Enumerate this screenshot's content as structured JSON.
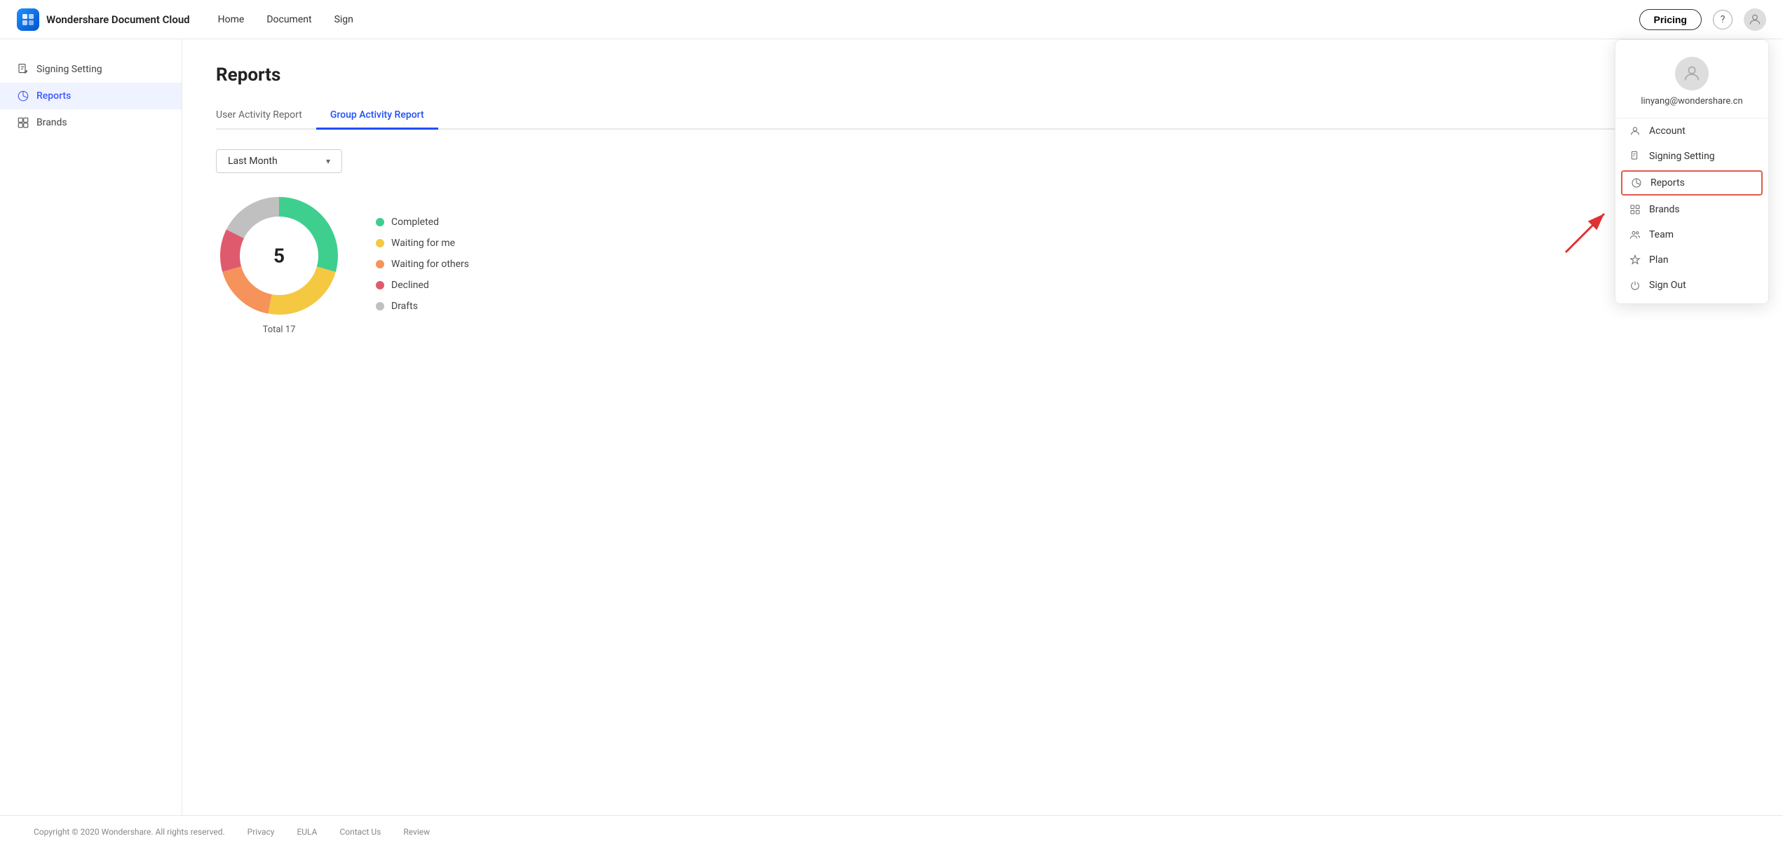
{
  "app": {
    "name": "Wondershare Document Cloud"
  },
  "topnav": {
    "links": [
      "Home",
      "Document",
      "Sign"
    ],
    "pricing_label": "Pricing",
    "help_icon": "?",
    "user_email": "linyang@wondershare.cn"
  },
  "sidebar": {
    "items": [
      {
        "id": "signing-setting",
        "label": "Signing Setting",
        "icon": "file-pen"
      },
      {
        "id": "reports",
        "label": "Reports",
        "icon": "chart",
        "active": true
      },
      {
        "id": "brands",
        "label": "Brands",
        "icon": "brand"
      }
    ]
  },
  "main": {
    "page_title": "Reports",
    "tabs": [
      {
        "id": "user-activity",
        "label": "User Activity Report",
        "active": false
      },
      {
        "id": "group-activity",
        "label": "Group Activity Report",
        "active": true
      }
    ],
    "filter": {
      "label": "Last Month"
    },
    "chart": {
      "total_number": "5",
      "total_label": "Total 17",
      "segments": [
        {
          "id": "completed",
          "label": "Completed",
          "color": "#3ecf8e",
          "value": 5
        },
        {
          "id": "waiting-for-me",
          "label": "Waiting for me",
          "color": "#f5c842",
          "value": 4
        },
        {
          "id": "waiting-for-others",
          "label": "Waiting for others",
          "color": "#f5935a",
          "value": 3
        },
        {
          "id": "declined",
          "label": "Declined",
          "color": "#e05a6e",
          "value": 2
        },
        {
          "id": "drafts",
          "label": "Drafts",
          "color": "#c0c0c0",
          "value": 3
        }
      ]
    }
  },
  "dropdown_menu": {
    "email": "linyang@wondershare.cn",
    "items": [
      {
        "id": "account",
        "label": "Account",
        "icon": "user"
      },
      {
        "id": "signing-setting",
        "label": "Signing Setting",
        "icon": "file"
      },
      {
        "id": "reports",
        "label": "Reports",
        "icon": "chart",
        "highlighted": true
      },
      {
        "id": "brands",
        "label": "Brands",
        "icon": "brand"
      },
      {
        "id": "team",
        "label": "Team",
        "icon": "team"
      },
      {
        "id": "plan",
        "label": "Plan",
        "icon": "plan"
      },
      {
        "id": "sign-out",
        "label": "Sign Out",
        "icon": "power"
      }
    ]
  },
  "footer": {
    "copyright": "Copyright © 2020 Wondershare. All rights reserved.",
    "links": [
      "Privacy",
      "EULA",
      "Contact Us",
      "Review"
    ]
  }
}
